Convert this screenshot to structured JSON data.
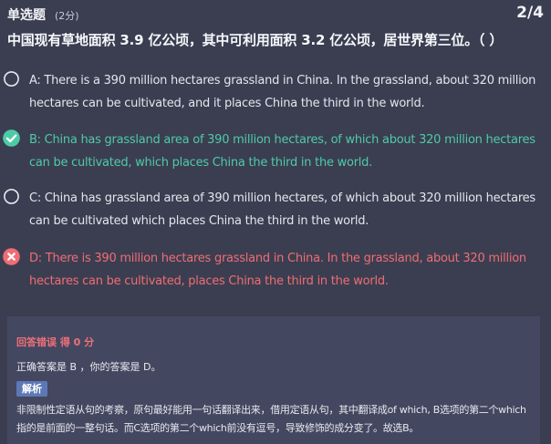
{
  "header": {
    "question_type": "单选题",
    "score": "(2分)",
    "progress": "2/4"
  },
  "question": {
    "stem": "中国现有草地面积 3.9 亿公顷，其中可利用面积 3.2 亿公顷，居世界第三位。（  ）"
  },
  "options": [
    {
      "text": "A: There is a 390 million hectares grassland in China. In the grassland, about 320 million hectares can be cultivated, and it places China the third in the world.",
      "state": "unselected",
      "icon": "radio-circle-icon"
    },
    {
      "text": "B: China has grassland area of 390 million hectares, of which about 320 million hectares can be cultivated, which places China the third in the world.",
      "state": "correct",
      "icon": "check-circle-icon",
      "color": "#4fcaa6"
    },
    {
      "text": "C: China has grassland area of 390 million hectares, of which about 320 million hectares can be cultivated which places China the third in the world.",
      "state": "unselected",
      "icon": "radio-circle-icon"
    },
    {
      "text": "D: There is 390 million hectares grassland in China. In the grassland, about 320 million hectares can be cultivated, places China the third in the world.",
      "state": "wrong",
      "icon": "x-circle-icon",
      "color": "#f06d73"
    }
  ],
  "analysis": {
    "result": "回答错误 得 0 分",
    "answer": "正确答案是 B ，你的答案是 D。",
    "tag": "解析",
    "explanation": "非限制性定语从句的考察，原句最好能用一句话翻译出来，借用定语从句，其中翻译成of which, B选项的第二个which指的是前面的一整句话。而C选项的第二个which前没有逗号，导致修饰的成分变了。故选B。"
  },
  "colors": {
    "background": "#3b3e51",
    "panel": "#444760",
    "correct": "#4fcaa6",
    "wrong": "#f06d73",
    "tag": "#5d78b6"
  }
}
